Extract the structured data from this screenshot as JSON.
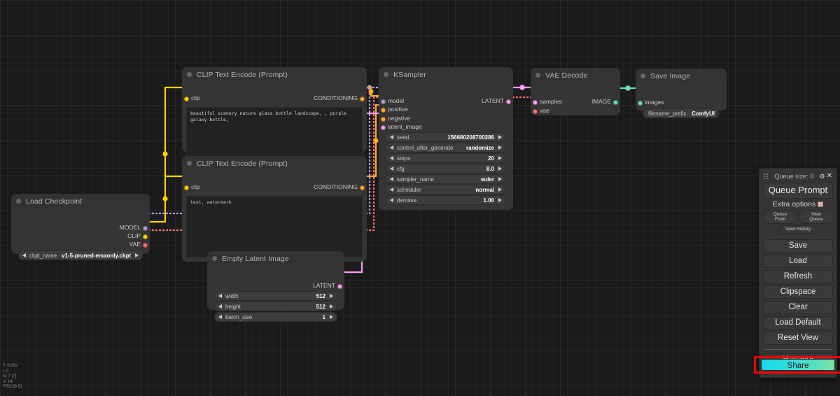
{
  "app": {
    "title": "ComfyUI"
  },
  "stats": {
    "time": "T: 0.00s",
    "iterations": "I: 0",
    "nodes": "N: 7 [7]",
    "version": "V: 14",
    "fps": "FPS:59.52"
  },
  "menu": {
    "queue_size_label": "Queue size: 0",
    "gear_icon": "gear-icon",
    "close_icon": "close-icon",
    "queue_prompt": "Queue Prompt",
    "extra_options": "Extra options",
    "queue_front": "Queue Front",
    "view_queue": "View Queue",
    "view_history": "View History",
    "save": "Save",
    "load": "Load",
    "refresh": "Refresh",
    "clipspace": "Clipspace",
    "clear": "Clear",
    "load_default": "Load Default",
    "reset_view": "Reset View",
    "manager": "Manager",
    "share": "Share",
    "share_gradient_from": "#14d8e8",
    "share_gradient_to": "#79e2a8",
    "highlight_color": "#ff0000"
  },
  "nodes": {
    "clip_positive": {
      "title": "CLIP Text Encode (Prompt)",
      "input_clip": "clip",
      "output_conditioning": "CONDITIONING",
      "text": "beautiful scenery nature glass bottle landscape, , purple galaxy bottle,"
    },
    "clip_negative": {
      "title": "CLIP Text Encode (Prompt)",
      "input_clip": "clip",
      "output_conditioning": "CONDITIONING",
      "text": "text, watermark"
    },
    "ksampler": {
      "title": "KSampler",
      "inputs": [
        "model",
        "positive",
        "negative",
        "latent_image"
      ],
      "output_latent": "LATENT",
      "widgets": [
        {
          "name": "seed",
          "value": "156680208700286"
        },
        {
          "name": "control_after_generate",
          "value": "randomize"
        },
        {
          "name": "steps",
          "value": "20"
        },
        {
          "name": "cfg",
          "value": "8.0"
        },
        {
          "name": "sampler_name",
          "value": "euler"
        },
        {
          "name": "scheduler",
          "value": "normal"
        },
        {
          "name": "denoise",
          "value": "1.00"
        }
      ]
    },
    "vae_decode": {
      "title": "VAE Decode",
      "inputs": [
        "samples",
        "vae"
      ],
      "output_image": "IMAGE"
    },
    "save_image": {
      "title": "Save Image",
      "input_images": "images",
      "widget": {
        "name": "filename_prefix",
        "value": "ComfyUI"
      }
    },
    "load_checkpoint": {
      "title": "Load Checkpoint",
      "outputs": [
        "MODEL",
        "CLIP",
        "VAE"
      ],
      "widget": {
        "name": "ckpt_name",
        "value": "v1-5-pruned-emaonly.ckpt"
      }
    },
    "empty_latent": {
      "title": "Empty Latent Image",
      "output_latent": "LATENT",
      "widgets": [
        {
          "name": "width",
          "value": "512"
        },
        {
          "name": "height",
          "value": "512"
        },
        {
          "name": "batch_size",
          "value": "1"
        }
      ]
    }
  },
  "colors": {
    "conditioning": "#ffa931",
    "model": "#b39ddb",
    "latent": "#ff9cf9",
    "vae": "#ff6e6e",
    "image": "#64e4c3",
    "clip": "#ffd500",
    "node_bg": "#353535",
    "canvas_bg": "#1a1a1a"
  }
}
